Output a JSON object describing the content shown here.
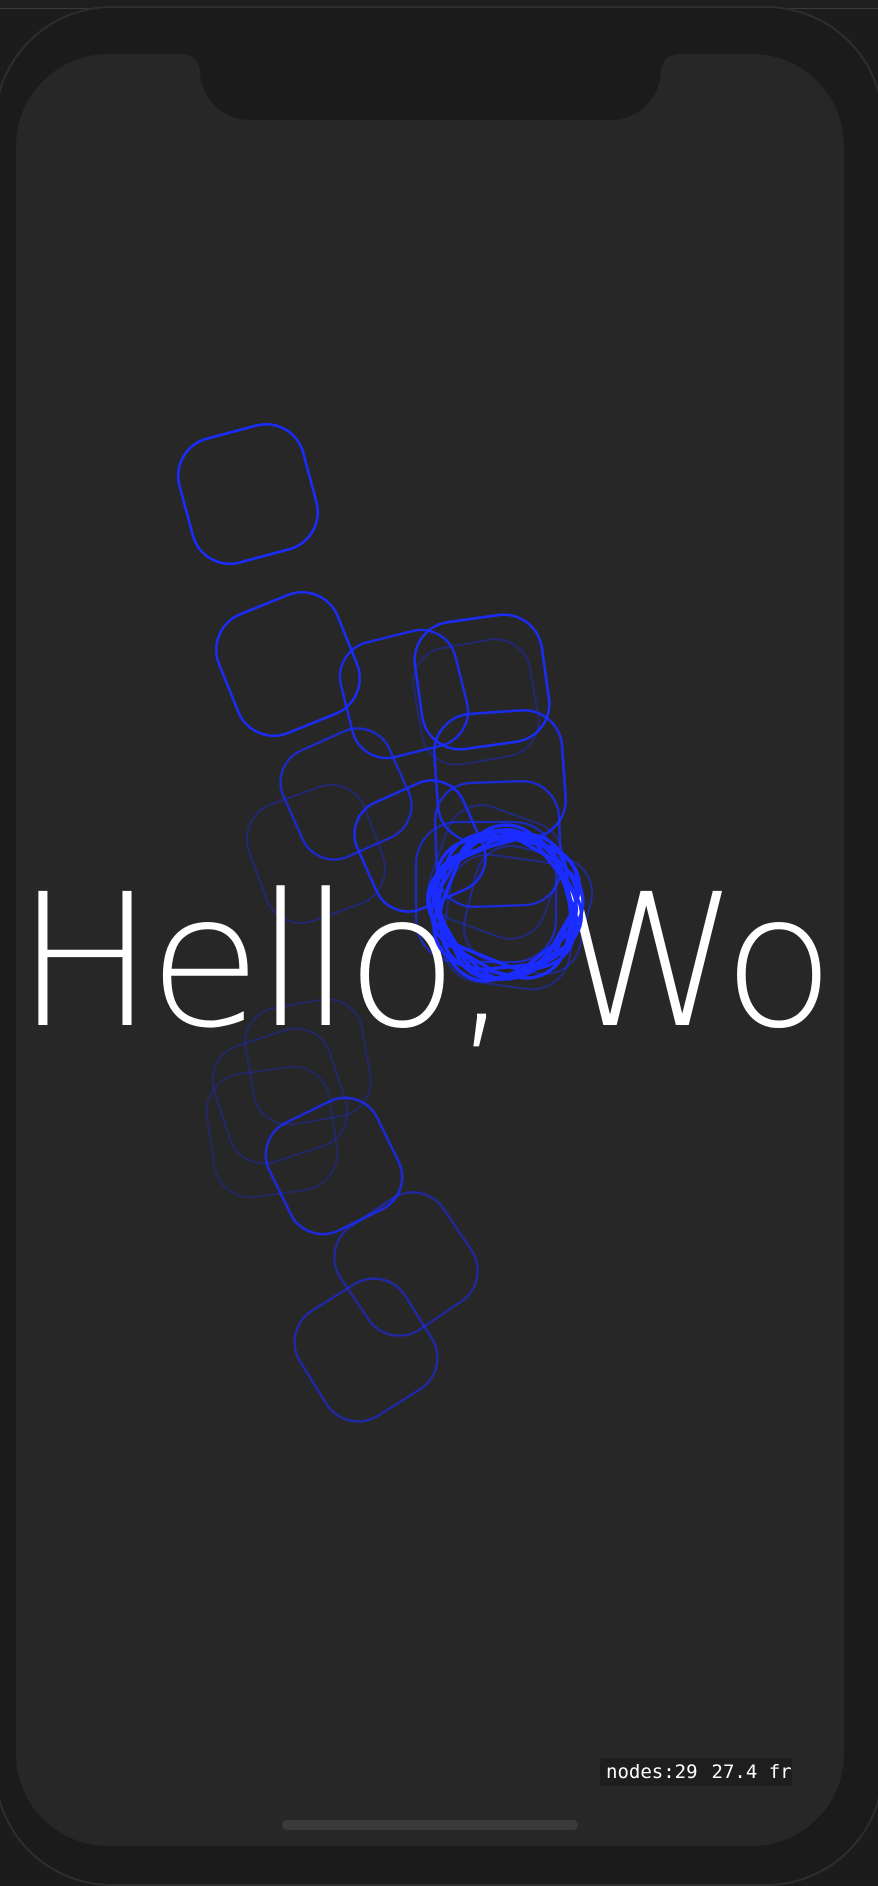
{
  "headline": "Hello, World",
  "stats": {
    "nodes_label": "nodes:29",
    "fps_label": "27.4 fr"
  },
  "colors": {
    "background": "#272727",
    "device_frame": "#1b1b1b",
    "shape_stroke": "#1a2cff",
    "text": "#ffffff"
  },
  "icons": {
    "node_shape": "rounded-square-outline-icon"
  }
}
